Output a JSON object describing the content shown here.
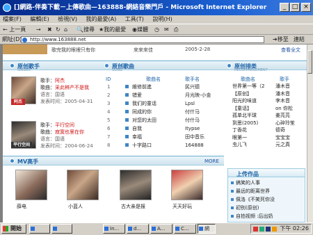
{
  "window": {
    "title": "[]網路-伴奏下載－上傳歌曲—163888-網絡音樂門戶 - Microsoft Internet Explorer",
    "min_glyph": "_",
    "max_glyph": "□",
    "close_glyph": "×"
  },
  "menu": [
    "檔案(F)",
    "編輯(E)",
    "檢視(V)",
    "我的最愛(A)",
    "工具(T)",
    "說明(H)"
  ],
  "toolbar": {
    "back": "上一頁",
    "forward": "→",
    "search": "搜尋",
    "favorites": "我的最愛",
    "media": "媒體"
  },
  "address": {
    "label": "網址(D)",
    "url": "http://www.163888.net",
    "go": "移至",
    "links": "連結"
  },
  "top_strip": {
    "row_text": "歌完我的眼裡只有你",
    "row_author": "來來來佳",
    "row_date": "2005-2-28",
    "more_link": "查看全文"
  },
  "sections": {
    "singers": {
      "title": "原创歌手",
      "sub": "SINGER"
    },
    "songs": {
      "title": "原创歌曲",
      "sub": "SONG"
    },
    "ranking": {
      "title": "原创排类",
      "sub": "RECOMMENDMENT"
    }
  },
  "singer_1": {
    "photo_tag": "阿杰",
    "line1_label": "歌手：",
    "line1_value": "阿杰",
    "line2_label": "歌曲：",
    "line2_value": "采此辨产不是我",
    "line3": "语言：国语",
    "line4": "发表时间：2005-04-31"
  },
  "singer_2": {
    "photo_tag": "平行空间",
    "line1_label": "歌手：",
    "line1_value": "平行空间",
    "line2_label": "歌曲：",
    "line2_value": "寂寞也里在你",
    "line3": "语言：国语",
    "line4": "发表时间：2004-06-24"
  },
  "songs_table": {
    "headers": [
      "ID",
      "歌曲名",
      "歌手名"
    ],
    "rows": [
      {
        "id": "1",
        "name": "維修前進",
        "singer": "民兴德"
      },
      {
        "id": "2",
        "name": "错爱",
        "singer": "月光映-小金"
      },
      {
        "id": "3",
        "name": "我们的童话",
        "singer": "Lpsl"
      },
      {
        "id": "4",
        "name": "同成的你",
        "singer": "付什马"
      },
      {
        "id": "5",
        "name": "对您的太田",
        "singer": "付什马"
      },
      {
        "id": "6",
        "name": "自我",
        "singer": "Itypse"
      },
      {
        "id": "7",
        "name": "幸福",
        "singer": "田中音乐"
      },
      {
        "id": "8",
        "name": "十字路口",
        "singer": "164888"
      }
    ]
  },
  "ranking_table": {
    "headers": [
      "歌曲名",
      "歌手"
    ],
    "rows": [
      {
        "name": "世界第一等（2",
        "singer": "潘木音"
      },
      {
        "name": "【原创】",
        "singer": "潘木音"
      },
      {
        "name": "阳光的味道",
        "singer": "李木音"
      },
      {
        "name": "【童话】",
        "singer": "on 你松"
      },
      {
        "name": "孤单北半球",
        "singer": "姜芫芫"
      },
      {
        "name": "到思(2005)",
        "singer": "心碎玲笙"
      },
      {
        "name": "丁香花",
        "singer": "德奇"
      },
      {
        "name": "眼第一",
        "singer": "宝宝宝"
      },
      {
        "name": "虫儿飞",
        "singer": "元之真"
      }
    ]
  },
  "mv_section": {
    "title": "MV高手",
    "more": "MORE"
  },
  "mv_items": [
    {
      "caption": "薛电"
    },
    {
      "caption": "小蓝人"
    },
    {
      "caption": "古大亲是报"
    },
    {
      "caption": "天天好玩"
    }
  ],
  "uploads": {
    "title": "上传作品",
    "items": [
      "搞笑的人事",
      "最远的距离世界",
      "佩洛《不笑死你没",
      "初别(原创)",
      "自拍视频 :后出奶"
    ]
  },
  "taskbar": {
    "start": "開始",
    "tasks": [
      "",
      "",
      "In...",
      "d...",
      "A...",
      "C...",
      "網"
    ],
    "clock": "下午 02:26"
  }
}
